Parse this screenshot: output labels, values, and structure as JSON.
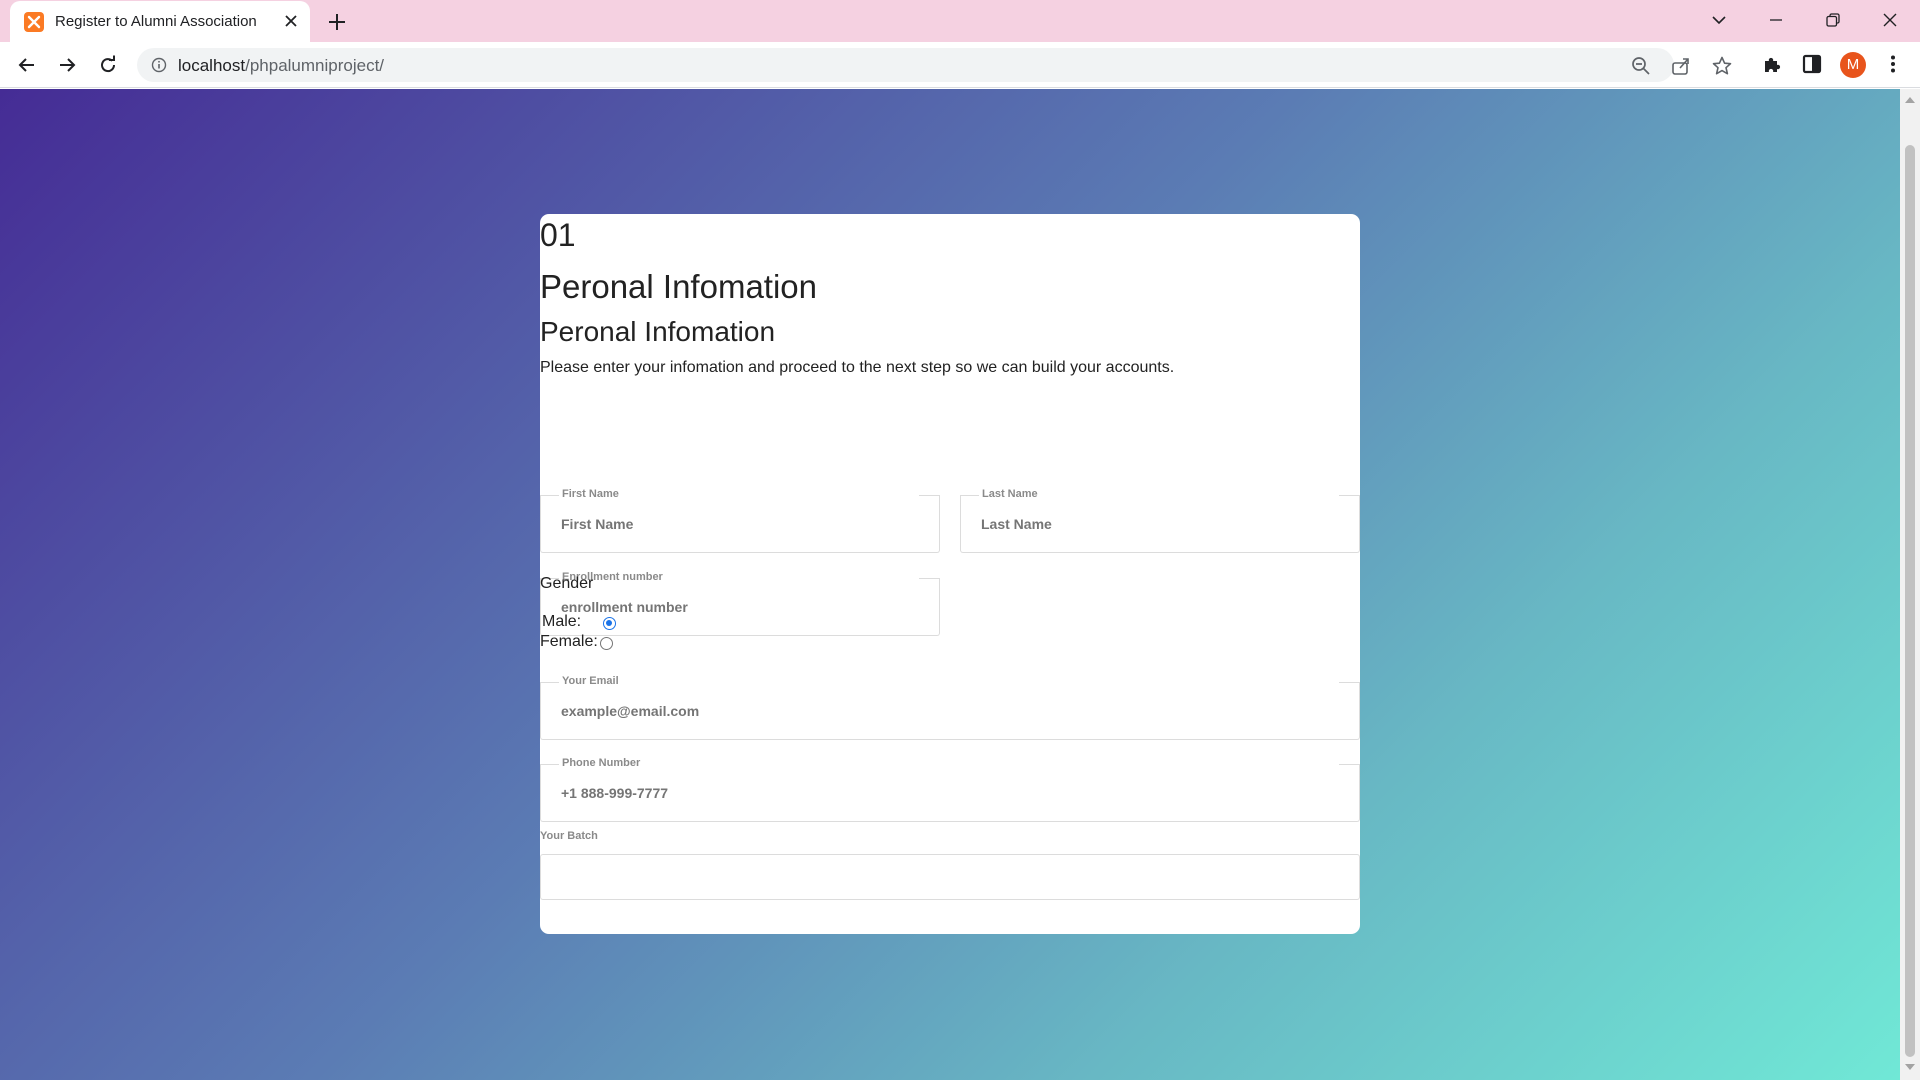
{
  "browser": {
    "tab_title": "Register to Alumni Association",
    "url_host": "localhost",
    "url_path": "/phpalumniproject/",
    "profile_initial": "M"
  },
  "form": {
    "step_number": "01",
    "title": "Peronal Infomation",
    "subtitle": "Peronal Infomation",
    "description": "Please enter your infomation and proceed to the next step so we can build your accounts.",
    "first_name": {
      "label": "First Name",
      "placeholder": "First Name"
    },
    "last_name": {
      "label": "Last Name",
      "placeholder": "Last Name"
    },
    "enrollment": {
      "label": "Enrollment number",
      "placeholder": "enrollment number"
    },
    "gender": {
      "label": "Gender",
      "options": [
        {
          "label": "Male:",
          "checked": true
        },
        {
          "label": "Female:",
          "checked": false
        }
      ]
    },
    "email": {
      "label": "Your Email",
      "placeholder": "example@email.com"
    },
    "phone": {
      "label": "Phone Number",
      "placeholder": "+1 888-999-7777"
    },
    "batch": {
      "label": "Your Batch",
      "value": ""
    }
  },
  "colors": {
    "tab_strip": "#f5d1e1",
    "gradient_start": "#452c95",
    "gradient_end": "#70e8d6",
    "radio_accent": "#1a73e8",
    "avatar": "#e8541c"
  }
}
